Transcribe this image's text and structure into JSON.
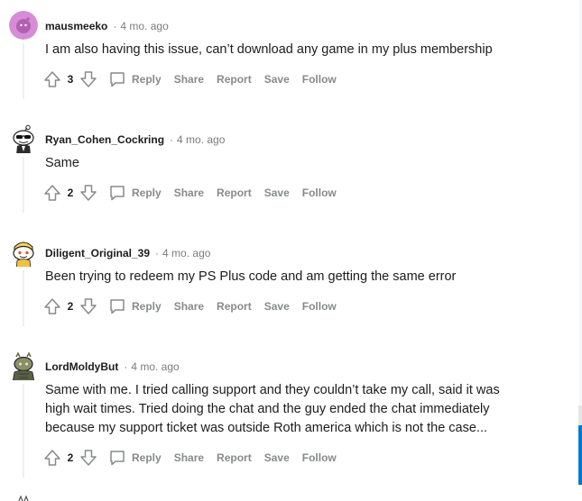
{
  "comments": [
    {
      "author": "mausmeeko",
      "separator": "·",
      "time": "4 mo. ago",
      "body": "I am also having this issue, can’t download any game in my plus membership",
      "score": "3",
      "avatar_icon": "snoo-default-purple-avatar"
    },
    {
      "author": "Ryan_Cohen_Cockring",
      "separator": "·",
      "time": "4 mo. ago",
      "body": "Same",
      "score": "2",
      "avatar_icon": "snoo-sunglasses-avatar"
    },
    {
      "author": "Diligent_Original_39",
      "separator": "·",
      "time": "4 mo. ago",
      "body": "Been trying to redeem my PS Plus code and am getting the same error",
      "score": "2",
      "avatar_icon": "snoo-yellow-cap-avatar"
    },
    {
      "author": "LordMoldyBut",
      "separator": "·",
      "time": "4 mo. ago",
      "body": "Same with me. I tried calling support and they couldn’t take my call, said it was high wait times. Tried doing the chat and the guy ended the chat immediately because my support ticket was outside Roth america which is not the case...",
      "score": "2",
      "avatar_icon": "snoo-armored-avatar"
    }
  ],
  "actions": {
    "reply": "Reply",
    "share": "Share",
    "report": "Report",
    "save": "Save",
    "follow": "Follow"
  },
  "colors": {
    "meta_gray": "#7c7c7c",
    "action_gray": "#878a8c",
    "thread_line": "#edeff1",
    "accent_blue": "#0079d3"
  }
}
